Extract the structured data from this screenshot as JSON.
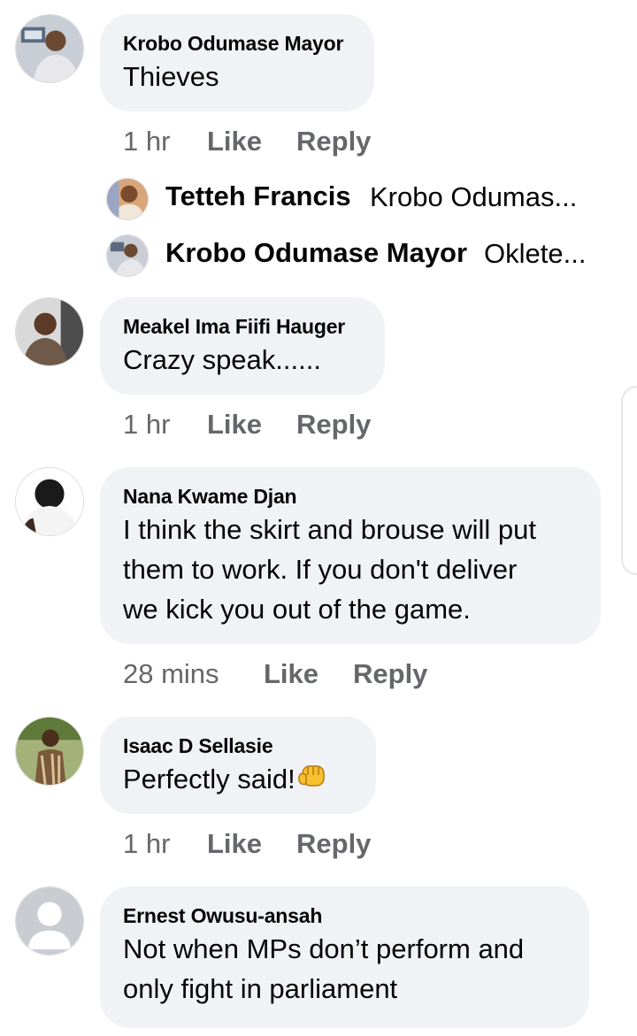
{
  "comments": [
    {
      "author": "Krobo Odumase Mayor",
      "text": "Thieves",
      "time": "1 hr",
      "like": "Like",
      "reply": "Reply",
      "replies": [
        {
          "author": "Tetteh Francis",
          "text": "Krobo Odumas..."
        },
        {
          "author": "Krobo Odumase Mayor",
          "text": "Oklete..."
        }
      ]
    },
    {
      "author": "Meakel Ima Fiifi Hauger",
      "text": "Crazy speak......",
      "time": "1 hr",
      "like": "Like",
      "reply": "Reply"
    },
    {
      "author": "Nana Kwame Djan",
      "lines": [
        "I think the skirt and brouse will put",
        "them to work. If you don't deliver",
        "we kick you out of the game."
      ],
      "time": "28 mins",
      "like": "Like",
      "reply": "Reply"
    },
    {
      "author": "Isaac D Sellasie",
      "text": "Perfectly said!",
      "emoji": "fist-emoji",
      "time": "1 hr",
      "like": "Like",
      "reply": "Reply"
    },
    {
      "author": "Ernest Owusu-ansah",
      "lines": [
        "Not when MPs don’t perform and",
        "only fight in parliament"
      ]
    }
  ],
  "colors": {
    "bubble": "#f0f2f5",
    "meta_text": "#65676b",
    "text": "#050505"
  }
}
